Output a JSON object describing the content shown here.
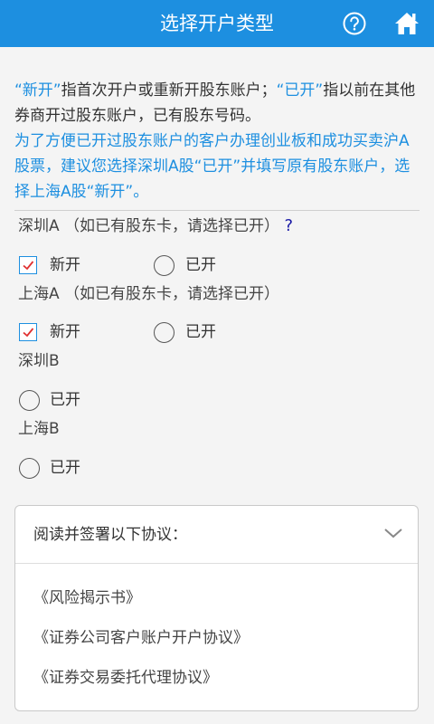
{
  "header": {
    "title": "选择开户类型"
  },
  "intro": {
    "seg1": "“新开”",
    "seg2": "指首次开户或重新开股东账户；",
    "seg3": "“已开”",
    "seg4": "指以前在其他券商开过股东账户，已有股东号码。",
    "seg5": "为了方便已开过股东账户的客户办理创业板和成功买卖沪A股票，建议您选择深圳A股“已开”并填写原有股东账户，选择上海A股“新开”。"
  },
  "markets": [
    {
      "label": "深圳A （如已有股东卡，请选择已开）",
      "hint": "?",
      "new_label": "新开",
      "open_label": "已开",
      "new_checked": true
    },
    {
      "label": "上海A （如已有股东卡，请选择已开）",
      "new_label": "新开",
      "open_label": "已开",
      "new_checked": true
    },
    {
      "label": "深圳B",
      "open_label": "已开"
    },
    {
      "label": "上海B",
      "open_label": "已开"
    }
  ],
  "agreements": {
    "heading": "阅读并签署以下协议：",
    "items": [
      "《风险揭示书》",
      "《证券公司客户账户开户协议》",
      "《证券交易委托代理协议》"
    ]
  },
  "colors": {
    "accent": "#1d8fe0",
    "check": "#e03030",
    "question": "#1a1aa6"
  }
}
